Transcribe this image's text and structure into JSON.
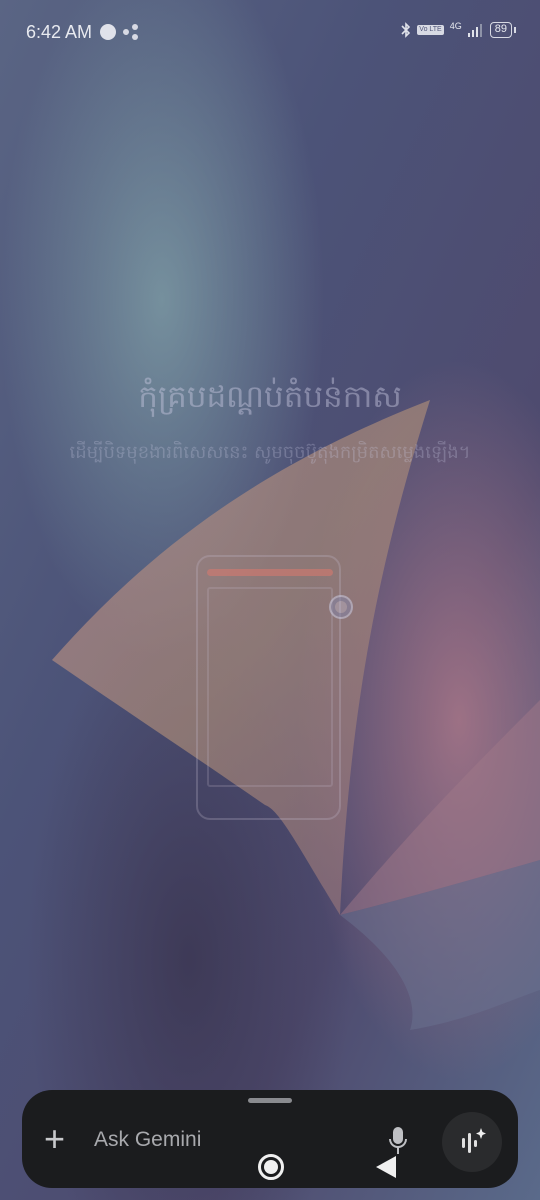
{
  "status_bar": {
    "time": "6:42 AM",
    "lte_label": "Vo LTE",
    "network": "4G",
    "battery": "89"
  },
  "overlay": {
    "title": "កុំគ្របដណ្ដប់តំបន់កាស",
    "subtitle": "ដើម្បីបិទមុខងារពិសេសនេះ សូមចុចប៊ូតុងកម្រិតសម្លេងឡើង។"
  },
  "gemini_bar": {
    "placeholder": "Ask Gemini"
  }
}
